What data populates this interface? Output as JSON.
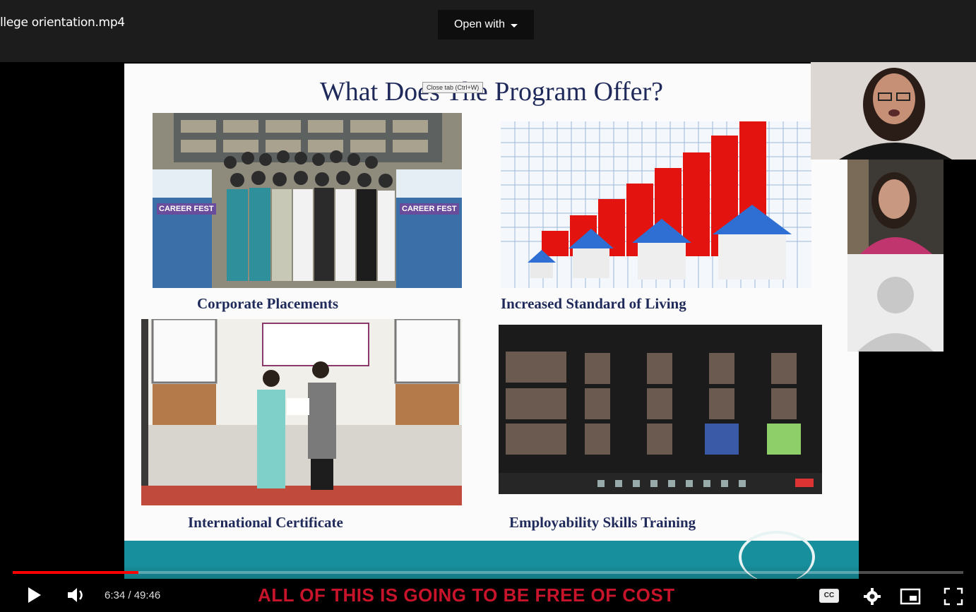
{
  "header": {
    "file_title": "llege orientation.mp4",
    "open_with_label": "Open with"
  },
  "slide": {
    "title": "What Does The Program Offer?",
    "tooltip": "Close tab (Ctrl+W)",
    "panels": [
      {
        "caption": "Corporate Placements",
        "banner_text": "CAREER FEST"
      },
      {
        "caption": "Increased Standard of Living"
      },
      {
        "caption": "International Certificate"
      },
      {
        "caption": "Employability Skills Training"
      }
    ]
  },
  "player": {
    "current_time": "6:34",
    "duration": "49:46",
    "time_separator": " / ",
    "progress_fraction": 0.132,
    "subtitle": "ALL OF THIS IS GOING TO BE FREE OF COST",
    "cc_label": "CC"
  },
  "colors": {
    "accent_red": "#ff0000",
    "subtitle_red": "#c8142a",
    "teal": "#178f9c",
    "slide_text": "#1f2a5a"
  }
}
